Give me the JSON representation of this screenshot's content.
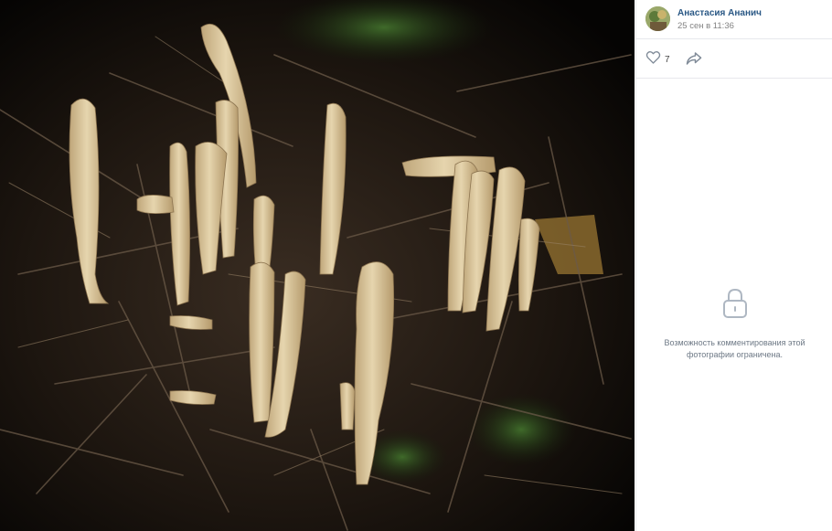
{
  "post": {
    "author_name": "Анастасия Ананич",
    "date": "25 сен в 11:36"
  },
  "actions": {
    "likes_count": "7",
    "like_icon": "heart-outline-icon",
    "share_icon": "share-arrow-icon"
  },
  "comments": {
    "restricted_icon": "lock-icon",
    "restricted_text": "Возможность комментирования этой фотографии ограничена."
  },
  "photo": {
    "subject_colors": {
      "mushroom": "#dcc9a2",
      "ground": "#1b140e",
      "moss": "#2f4a20"
    }
  },
  "colors": {
    "link": "#2a5885",
    "muted": "#828282",
    "border": "#e7e8ec"
  }
}
